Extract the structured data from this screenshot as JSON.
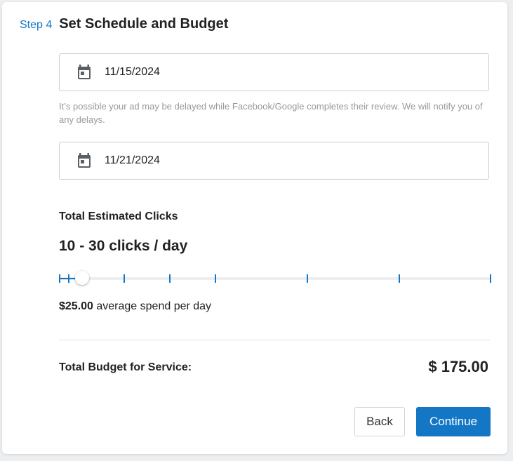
{
  "step": {
    "label": "Step 4",
    "title": "Set Schedule and Budget"
  },
  "schedule": {
    "start_date": "11/15/2024",
    "end_date": "11/21/2024",
    "icon": "calendar-icon",
    "review_note": "It’s possible your ad may be delayed while Facebook/Google completes their review. We will notify you of any delays."
  },
  "clicks": {
    "label": "Total Estimated Clicks",
    "value": "10 - 30 clicks / day"
  },
  "budget_slider": {
    "level_fraction": 0.04
  },
  "spend": {
    "amount": "$25.00",
    "suffix": " average spend per day"
  },
  "total": {
    "label": "Total Budget for Service:",
    "value": "$ 175.00"
  },
  "actions": {
    "back_label": "Back",
    "continue_label": "Continue"
  },
  "colors": {
    "accent": "#1477c5",
    "muted_text": "#999999"
  }
}
